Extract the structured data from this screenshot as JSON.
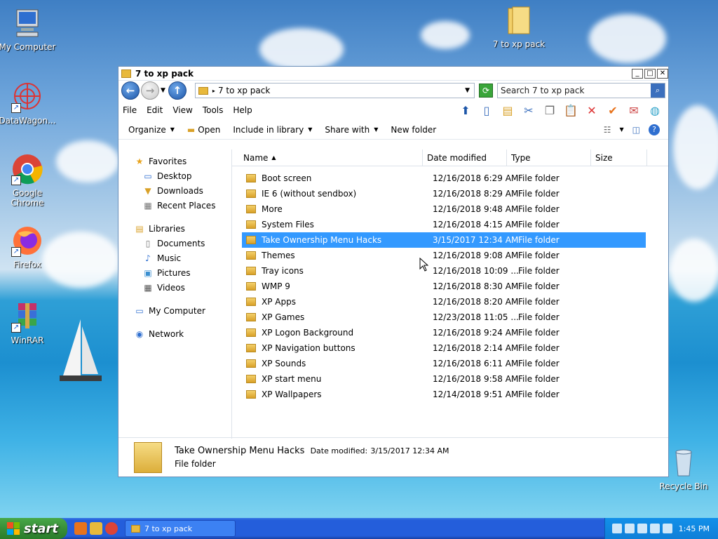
{
  "desktop": {
    "icons": [
      {
        "label": "My Computer"
      },
      {
        "label": "DataWagon..."
      },
      {
        "label": "Google Chrome"
      },
      {
        "label": "Firefox"
      },
      {
        "label": "WinRAR"
      },
      {
        "label": "7 to xp pack"
      },
      {
        "label": "Recycle Bin"
      }
    ]
  },
  "window": {
    "title": "7 to xp pack",
    "address_path": "7 to xp pack",
    "search_placeholder": "Search 7 to xp pack",
    "menu": [
      "File",
      "Edit",
      "View",
      "Tools",
      "Help"
    ],
    "commands": {
      "organize": "Organize",
      "open": "Open",
      "include": "Include in library",
      "share": "Share with",
      "new_folder": "New folder"
    }
  },
  "navpane": {
    "favorites": "Favorites",
    "favorites_items": [
      "Desktop",
      "Downloads",
      "Recent Places"
    ],
    "libraries": "Libraries",
    "libraries_items": [
      "Documents",
      "Music",
      "Pictures",
      "Videos"
    ],
    "my_computer": "My Computer",
    "network": "Network"
  },
  "columns": {
    "name": "Name",
    "date": "Date modified",
    "type": "Type",
    "size": "Size"
  },
  "files": [
    {
      "name": "Boot screen",
      "date": "12/16/2018 6:29 AM",
      "type": "File folder"
    },
    {
      "name": "IE 6 (without sendbox)",
      "date": "12/16/2018 8:29 AM",
      "type": "File folder"
    },
    {
      "name": "More",
      "date": "12/16/2018 9:48 AM",
      "type": "File folder"
    },
    {
      "name": "System Files",
      "date": "12/16/2018 4:15 AM",
      "type": "File folder"
    },
    {
      "name": "Take Ownership Menu Hacks",
      "date": "3/15/2017 12:34 AM",
      "type": "File folder"
    },
    {
      "name": "Themes",
      "date": "12/16/2018 9:08 AM",
      "type": "File folder"
    },
    {
      "name": "Tray icons",
      "date": "12/16/2018 10:09 ...",
      "type": "File folder"
    },
    {
      "name": "WMP 9",
      "date": "12/16/2018 8:30 AM",
      "type": "File folder"
    },
    {
      "name": "XP Apps",
      "date": "12/16/2018 8:20 AM",
      "type": "File folder"
    },
    {
      "name": "XP Games",
      "date": "12/23/2018 11:05 ...",
      "type": "File folder"
    },
    {
      "name": "XP Logon Background",
      "date": "12/16/2018 9:24 AM",
      "type": "File folder"
    },
    {
      "name": "XP Navigation buttons",
      "date": "12/16/2018 2:14 AM",
      "type": "File folder"
    },
    {
      "name": "XP Sounds",
      "date": "12/16/2018 6:11 AM",
      "type": "File folder"
    },
    {
      "name": "XP start menu",
      "date": "12/16/2018 9:58 AM",
      "type": "File folder"
    },
    {
      "name": "XP Wallpapers",
      "date": "12/14/2018 9:51 AM",
      "type": "File folder"
    }
  ],
  "details": {
    "name": "Take Ownership Menu Hacks",
    "date_label": "Date modified:",
    "date_value": "3/15/2017 12:34 AM",
    "type": "File folder"
  },
  "taskbar": {
    "start": "start",
    "task_label": "7 to xp pack",
    "clock": "1:45 PM"
  },
  "colors": {
    "selection": "#3399ff",
    "taskbar": "#245edb",
    "start": "#388e38"
  }
}
